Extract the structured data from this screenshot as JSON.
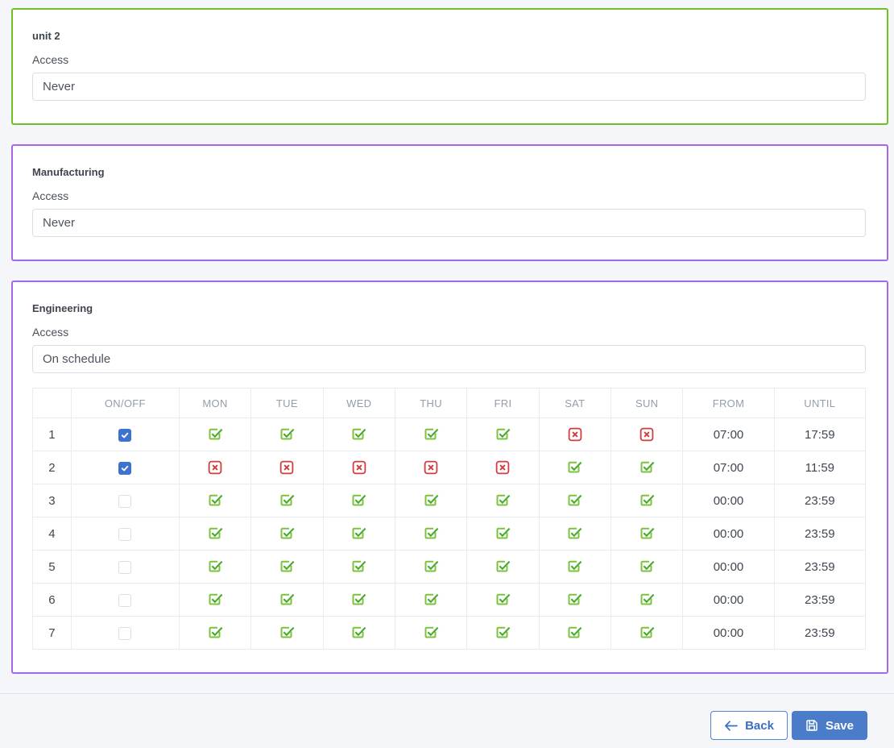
{
  "colors": {
    "page_bg": "#f5f6fa",
    "green_border": "#6fbf25",
    "purple_border": "#a866e8",
    "checkbox_on": "#3e72d0",
    "day_on_box": "#7cc33c",
    "day_on_check": "#47aa2e",
    "day_off": "#d23c3c",
    "button_blue": "#4a7cca",
    "button_blue_text": "#3a6ec6"
  },
  "cards": [
    {
      "title": "unit 2",
      "access_label": "Access",
      "access_value": "Never",
      "border": "green"
    },
    {
      "title": "Manufacturing",
      "access_label": "Access",
      "access_value": "Never",
      "border": "purple"
    },
    {
      "title": "Engineering",
      "access_label": "Access",
      "access_value": "On schedule",
      "border": "purple"
    }
  ],
  "schedule": {
    "headers": {
      "row": "",
      "onoff": "ON/OFF",
      "days": [
        "MON",
        "TUE",
        "WED",
        "THU",
        "FRI",
        "SAT",
        "SUN"
      ],
      "from": "FROM",
      "until": "UNTIL"
    },
    "rows": [
      {
        "num": "1",
        "enabled": true,
        "days": [
          true,
          true,
          true,
          true,
          true,
          false,
          false
        ],
        "from": "07:00",
        "until": "17:59"
      },
      {
        "num": "2",
        "enabled": true,
        "days": [
          false,
          false,
          false,
          false,
          false,
          true,
          true
        ],
        "from": "07:00",
        "until": "11:59"
      },
      {
        "num": "3",
        "enabled": false,
        "days": [
          true,
          true,
          true,
          true,
          true,
          true,
          true
        ],
        "from": "00:00",
        "until": "23:59"
      },
      {
        "num": "4",
        "enabled": false,
        "days": [
          true,
          true,
          true,
          true,
          true,
          true,
          true
        ],
        "from": "00:00",
        "until": "23:59"
      },
      {
        "num": "5",
        "enabled": false,
        "days": [
          true,
          true,
          true,
          true,
          true,
          true,
          true
        ],
        "from": "00:00",
        "until": "23:59"
      },
      {
        "num": "6",
        "enabled": false,
        "days": [
          true,
          true,
          true,
          true,
          true,
          true,
          true
        ],
        "from": "00:00",
        "until": "23:59"
      },
      {
        "num": "7",
        "enabled": false,
        "days": [
          true,
          true,
          true,
          true,
          true,
          true,
          true
        ],
        "from": "00:00",
        "until": "23:59"
      }
    ]
  },
  "footer": {
    "back_label": "Back",
    "save_label": "Save"
  }
}
